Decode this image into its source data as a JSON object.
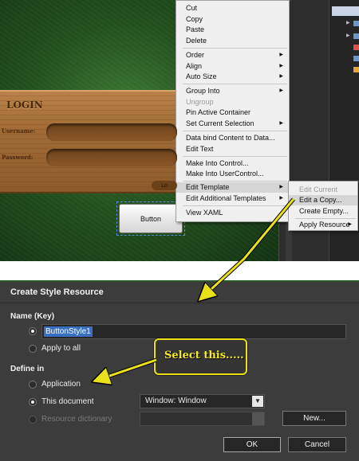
{
  "designer": {
    "login_title": "LOGIN",
    "username_label": "Username:",
    "password_label": "Password:",
    "wood_button_label": "Lo",
    "artboard_button_label": "Button"
  },
  "context_menu": {
    "items": {
      "cut": "Cut",
      "copy": "Copy",
      "paste": "Paste",
      "delete": "Delete",
      "order": "Order",
      "align": "Align",
      "auto_size": "Auto Size",
      "group_into": "Group Into",
      "ungroup": "Ungroup",
      "pin_active_container": "Pin Active Container",
      "set_current_selection": "Set Current Selection",
      "data_bind": "Data bind Content to Data...",
      "edit_text": "Edit Text",
      "make_into_control": "Make Into Control...",
      "make_into_usercontrol": "Make Into UserControl...",
      "edit_template": "Edit Template",
      "edit_additional_templates": "Edit Additional Templates",
      "view_xaml": "View XAML"
    },
    "submenu": {
      "edit_current": "Edit Current",
      "edit_a_copy": "Edit a Copy...",
      "create_empty": "Create Empty...",
      "apply_resource": "Apply Resource"
    }
  },
  "dialog": {
    "title": "Create Style Resource",
    "name_heading": "Name (Key)",
    "name_value": "ButtonStyle1",
    "apply_to_all": "Apply to all",
    "define_in_heading": "Define in",
    "application": "Application",
    "this_document": "This document",
    "document_option": "Window: Window",
    "resource_dictionary": "Resource dictionary",
    "new_button": "New...",
    "ok_button": "OK",
    "cancel_button": "Cancel"
  },
  "annotation": {
    "callout_text": "Select this.....",
    "highlight_color": "#e9e01a"
  }
}
